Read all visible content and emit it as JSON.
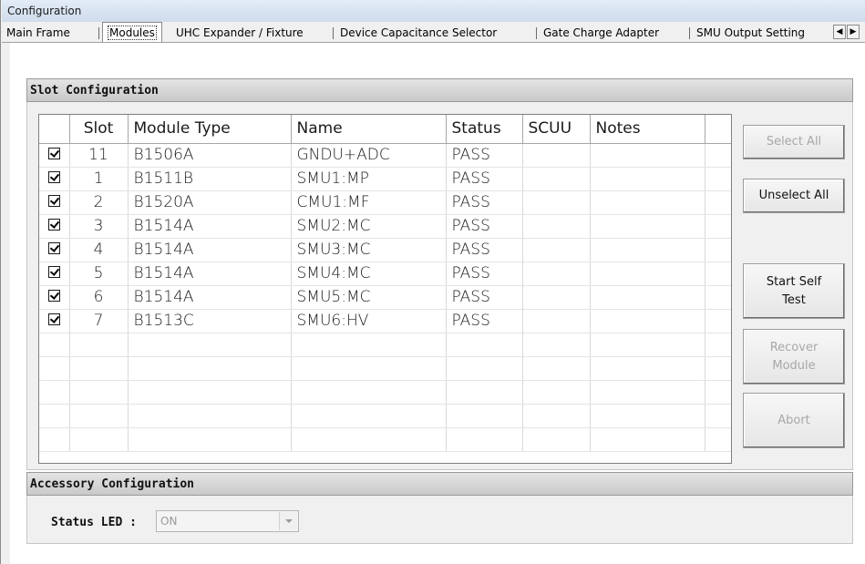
{
  "window": {
    "title": "Configuration"
  },
  "tabs": [
    {
      "label": "Main Frame"
    },
    {
      "label": "Modules"
    },
    {
      "label": "UHC Expander / Fixture"
    },
    {
      "label": "Device Capacitance Selector"
    },
    {
      "label": "Gate Charge Adapter"
    },
    {
      "label": "SMU Output Setting"
    }
  ],
  "tab_scroll": {
    "left": "◀",
    "right": "▶"
  },
  "slot_config": {
    "header": "Slot Configuration",
    "columns": [
      "Slot",
      "Module Type",
      "Name",
      "Status",
      "SCUU",
      "Notes"
    ],
    "rows": [
      {
        "checked": true,
        "slot": "11",
        "module_type": "B1506A",
        "name": "GNDU+ADC",
        "status": "PASS",
        "scuu": "",
        "notes": ""
      },
      {
        "checked": true,
        "slot": "1",
        "module_type": "B1511B",
        "name": "SMU1:MP",
        "status": "PASS",
        "scuu": "",
        "notes": ""
      },
      {
        "checked": true,
        "slot": "2",
        "module_type": "B1520A",
        "name": "CMU1:MF",
        "status": "PASS",
        "scuu": "",
        "notes": ""
      },
      {
        "checked": true,
        "slot": "3",
        "module_type": "B1514A",
        "name": "SMU2:MC",
        "status": "PASS",
        "scuu": "",
        "notes": ""
      },
      {
        "checked": true,
        "slot": "4",
        "module_type": "B1514A",
        "name": "SMU3:MC",
        "status": "PASS",
        "scuu": "",
        "notes": ""
      },
      {
        "checked": true,
        "slot": "5",
        "module_type": "B1514A",
        "name": "SMU4:MC",
        "status": "PASS",
        "scuu": "",
        "notes": ""
      },
      {
        "checked": true,
        "slot": "6",
        "module_type": "B1514A",
        "name": "SMU5:MC",
        "status": "PASS",
        "scuu": "",
        "notes": ""
      },
      {
        "checked": true,
        "slot": "7",
        "module_type": "B1513C",
        "name": "SMU6:HV",
        "status": "PASS",
        "scuu": "",
        "notes": ""
      }
    ],
    "buttons": {
      "select_all": "Select All",
      "unselect_all": "Unselect All",
      "start_self_test": "Start Self\nTest",
      "recover_module": "Recover\nModule",
      "abort": "Abort"
    }
  },
  "accessory_config": {
    "header": "Accessory Configuration",
    "status_led_label": "Status LED :",
    "status_led_value": "ON"
  },
  "colors": {
    "header_gradient_top": "#e4e4e4",
    "header_gradient_bottom": "#c9c9c9",
    "disabled_text": "#a8a8a8"
  }
}
